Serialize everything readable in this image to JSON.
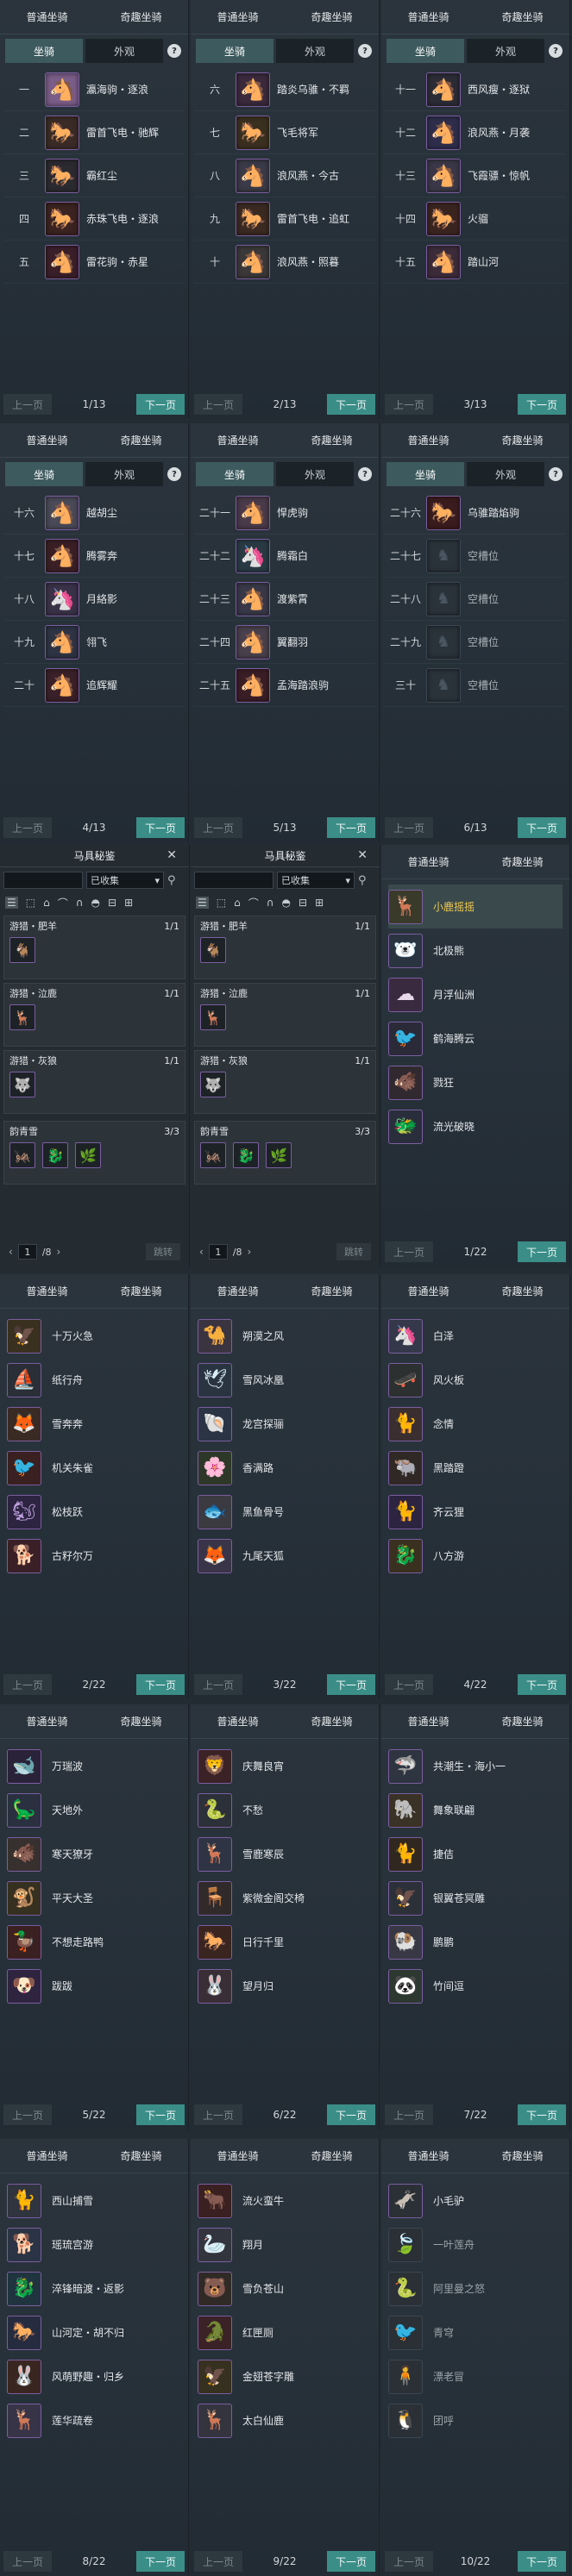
{
  "tabs": {
    "normal": "普通坐骑",
    "fun": "奇趣坐骑",
    "mount": "坐骑",
    "appearance": "外观",
    "help": "?"
  },
  "pager": {
    "prev": "上一页",
    "next": "下一页"
  },
  "mount_pages": [
    {
      "page": "1/13",
      "rows": [
        {
          "rank": "一",
          "name": "瀛海驹・逐浪",
          "icon": "🐴",
          "color": "#b9c7d6",
          "bg": "#7a5d88"
        },
        {
          "rank": "二",
          "name": "雷首飞电・驰辉",
          "icon": "🐎",
          "color": "#e0a040",
          "bg": "#3a2b26"
        },
        {
          "rank": "三",
          "name": "霸红尘",
          "icon": "🐎",
          "color": "#e4e7ea",
          "bg": "#2b2a30"
        },
        {
          "rank": "四",
          "name": "赤珠飞电・逐浪",
          "icon": "🐎",
          "color": "#e47a3a",
          "bg": "#3a2320"
        },
        {
          "rank": "五",
          "name": "雷花驹・赤星",
          "icon": "🐴",
          "color": "#d44a5a",
          "bg": "#3a1f2a"
        }
      ]
    },
    {
      "page": "2/13",
      "rows": [
        {
          "rank": "六",
          "name": "踏炎乌骓・不羁",
          "icon": "🐴",
          "color": "#e0e4e8",
          "bg": "#3a2a3c"
        },
        {
          "rank": "七",
          "name": "飞毛将军",
          "icon": "🐎",
          "color": "#e8b84a",
          "bg": "#3a3020"
        },
        {
          "rank": "八",
          "name": "浪风燕・今古",
          "icon": "🐴",
          "color": "#e6eaee",
          "bg": "#3a3a48"
        },
        {
          "rank": "九",
          "name": "雷首飞电・追虹",
          "icon": "🐎",
          "color": "#e6b048",
          "bg": "#3a2a22"
        },
        {
          "rank": "十",
          "name": "浪风燕・照暮",
          "icon": "🐴",
          "color": "#e8e4d8",
          "bg": "#3a3838"
        }
      ]
    },
    {
      "page": "3/13",
      "rows": [
        {
          "rank": "十一",
          "name": "西风瘦・逐狱",
          "icon": "🐴",
          "color": "#cfd5dd",
          "bg": "#2c2c36"
        },
        {
          "rank": "十二",
          "name": "浪风燕・月袭",
          "icon": "🐴",
          "color": "#a4b7e8",
          "bg": "#2e2e4c"
        },
        {
          "rank": "十三",
          "name": "飞霞骠・惊帆",
          "icon": "🐴",
          "color": "#e8ecef",
          "bg": "#3a3848"
        },
        {
          "rank": "十四",
          "name": "火骝",
          "icon": "🐎",
          "color": "#ea7a3a",
          "bg": "#3a2420"
        },
        {
          "rank": "十五",
          "name": "踏山河",
          "icon": "🐴",
          "color": "#e8d8dc",
          "bg": "#3c2c3a"
        }
      ]
    },
    {
      "page": "4/13",
      "rows": [
        {
          "rank": "十六",
          "name": "越胡尘",
          "icon": "🐴",
          "color": "#2a2f36",
          "bg": "#4a4a58"
        },
        {
          "rank": "十七",
          "name": "腾雾奔",
          "icon": "🐴",
          "color": "#e25a3a",
          "bg": "#3a2026"
        },
        {
          "rank": "十八",
          "name": "月絡影",
          "icon": "🦄",
          "color": "#e6e8f4",
          "bg": "#3a3248"
        },
        {
          "rank": "十九",
          "name": "翎飞",
          "icon": "🐴",
          "color": "#c0c8d8",
          "bg": "#2e3444"
        },
        {
          "rank": "二十",
          "name": "追辉耀",
          "icon": "🐴",
          "color": "#e86a4a",
          "bg": "#3a2028"
        }
      ]
    },
    {
      "page": "5/13",
      "rows": [
        {
          "rank": "二十一",
          "name": "悍虎驹",
          "icon": "🐴",
          "color": "#d8dce8",
          "bg": "#4a3a4a"
        },
        {
          "rank": "二十二",
          "name": "腾霜白",
          "icon": "🦄",
          "color": "#dcf0f4",
          "bg": "#2a3a44"
        },
        {
          "rank": "二十三",
          "name": "渡紫霄",
          "icon": "🐴",
          "color": "#e8ecf0",
          "bg": "#383848"
        },
        {
          "rank": "二十四",
          "name": "翼翻羽",
          "icon": "🐴",
          "color": "#2c2a30",
          "bg": "#48404c"
        },
        {
          "rank": "二十五",
          "name": "孟海踏浪驹",
          "icon": "🐴",
          "color": "#e04a4a",
          "bg": "#3a1e26"
        }
      ]
    },
    {
      "page": "6/13",
      "rows": [
        {
          "rank": "二十六",
          "name": "乌骓踏焰驹",
          "icon": "🐎",
          "color": "#e4483a",
          "bg": "#3a1c1e",
          "empty": false
        },
        {
          "rank": "二十七",
          "name": "空槽位",
          "icon": "♞",
          "empty": true
        },
        {
          "rank": "二十八",
          "name": "空槽位",
          "icon": "♞",
          "empty": true
        },
        {
          "rank": "二十九",
          "name": "空槽位",
          "icon": "♞",
          "empty": true
        },
        {
          "rank": "三十",
          "name": "空槽位",
          "icon": "♞",
          "empty": true
        }
      ]
    }
  ],
  "codex": {
    "title": "马具秘鉴",
    "close": "✕",
    "search_placeholder": "",
    "filter_value": "已收集",
    "sets": [
      {
        "name": "游猎・肥羊",
        "count": "1/1",
        "items": [
          "🐐"
        ]
      },
      {
        "name": "游猎・泣鹿",
        "count": "1/1",
        "items": [
          "🦌"
        ]
      },
      {
        "name": "游猎・灰狼",
        "count": "1/1",
        "items": [
          "🐺"
        ]
      }
    ],
    "set_bottom": {
      "name": "韵青雪",
      "count": "3/3",
      "items": [
        "🦗",
        "🐉",
        "🌿"
      ]
    },
    "page_current": "1",
    "page_total": "/8",
    "jump": "跳转"
  },
  "fun_pages": [
    {
      "page": "1/22",
      "rows": [
        {
          "name": "小鹿摇摇",
          "icon": "🦌",
          "color": "#f0c060",
          "bg": "#3a3a2a",
          "selected": true
        },
        {
          "name": "北极熊",
          "icon": "🐻‍❄️",
          "color": "#e8f0f4",
          "bg": "#2a3440"
        },
        {
          "name": "月浮仙洲",
          "icon": "☁",
          "color": "#e8d8ea",
          "bg": "#3a2a40"
        },
        {
          "name": "鹤海腾云",
          "icon": "🐦",
          "color": "#f0f0f0",
          "bg": "#2a2a38"
        },
        {
          "name": "戮狂",
          "icon": "🐗",
          "color": "#d8d8d8",
          "bg": "#302a30"
        },
        {
          "name": "流光破晓",
          "icon": "🐲",
          "color": "#d8e8f0",
          "bg": "#2a2e3c"
        }
      ]
    },
    {
      "page": "2/22",
      "rows": [
        {
          "name": "十万火急",
          "icon": "🦅",
          "color": "#f0b040",
          "bg": "#3a3020"
        },
        {
          "name": "纸行舟",
          "icon": "⛵",
          "color": "#e8e8e8",
          "bg": "#2a2e36"
        },
        {
          "name": "雪奔奔",
          "icon": "🦊",
          "color": "#e8d8c0",
          "bg": "#3a2a24"
        },
        {
          "name": "机关朱雀",
          "icon": "🐦",
          "color": "#e85a3a",
          "bg": "#3a2020"
        },
        {
          "name": "松枝跃",
          "icon": "🐿",
          "color": "#c0a0e0",
          "bg": "#2c2440"
        },
        {
          "name": "古籽尔万",
          "icon": "🐕",
          "color": "#e06a6a",
          "bg": "#3a2026"
        }
      ]
    },
    {
      "page": "3/22",
      "rows": [
        {
          "name": "朔漠之风",
          "icon": "🐪",
          "color": "#e8e4dc",
          "bg": "#3a3440"
        },
        {
          "name": "雪风冰凰",
          "icon": "🕊",
          "color": "#d8eef8",
          "bg": "#2a3440"
        },
        {
          "name": "龙宫探骊",
          "icon": "🐚",
          "color": "#c8e0f0",
          "bg": "#2a3444"
        },
        {
          "name": "香满路",
          "icon": "🌸",
          "color": "#e0e8a0",
          "bg": "#2e3828"
        },
        {
          "name": "黑鱼骨号",
          "icon": "🐟",
          "color": "#2a2a2e",
          "bg": "#3a3a40"
        },
        {
          "name": "九尾天狐",
          "icon": "🦊",
          "color": "#f0f0f4",
          "bg": "#3a3448"
        }
      ]
    },
    {
      "page": "4/22",
      "rows": [
        {
          "name": "白泽",
          "icon": "🦄",
          "color": "#e8ecf0",
          "bg": "#34384a"
        },
        {
          "name": "风火板",
          "icon": "🛹",
          "color": "#e0a060",
          "bg": "#2c3030"
        },
        {
          "name": "念情",
          "icon": "🐈",
          "color": "#e8d8d0",
          "bg": "#3a2e30"
        },
        {
          "name": "黑踏蹬",
          "icon": "🐃",
          "color": "#d8a870",
          "bg": "#302824"
        },
        {
          "name": "齐云狸",
          "icon": "🐈",
          "color": "#c080e0",
          "bg": "#2c2440"
        },
        {
          "name": "八方游",
          "icon": "🐉",
          "color": "#e0b040",
          "bg": "#3a3020"
        }
      ]
    },
    {
      "page": "5/22",
      "rows": [
        {
          "name": "万瑞波",
          "icon": "🐋",
          "color": "#a050c0",
          "bg": "#2a2238"
        },
        {
          "name": "天地外",
          "icon": "🦕",
          "color": "#c8d8e8",
          "bg": "#2a3040"
        },
        {
          "name": "寒天獠牙",
          "icon": "🐗",
          "color": "#e0d8d0",
          "bg": "#36302e"
        },
        {
          "name": "平天大圣",
          "icon": "🐒",
          "color": "#e0c048",
          "bg": "#363020"
        },
        {
          "name": "不想走路鸭",
          "icon": "🦆",
          "color": "#e84a3a",
          "bg": "#3a2020"
        },
        {
          "name": "跋跋",
          "icon": "🐶",
          "color": "#c070d0",
          "bg": "#2e2440"
        }
      ]
    },
    {
      "page": "6/22",
      "rows": [
        {
          "name": "庆舞良宵",
          "icon": "🦁",
          "color": "#e04a4a",
          "bg": "#3a2226"
        },
        {
          "name": "不愁",
          "icon": "🐍",
          "color": "#d8dce0",
          "bg": "#2c3038"
        },
        {
          "name": "雪鹿寒辰",
          "icon": "🦌",
          "color": "#e8f0f8",
          "bg": "#2e3444"
        },
        {
          "name": "紫微金阁交椅",
          "icon": "🪑",
          "color": "#c0a050",
          "bg": "#302a2a"
        },
        {
          "name": "日行千里",
          "icon": "🐎",
          "color": "#e06040",
          "bg": "#3a2420"
        },
        {
          "name": "望月归",
          "icon": "🐰",
          "color": "#e0b8c8",
          "bg": "#3a2e36"
        }
      ]
    },
    {
      "page": "7/22",
      "rows": [
        {
          "name": "共潮生・海小一",
          "icon": "🦈",
          "color": "#d8e0e8",
          "bg": "#2e3440"
        },
        {
          "name": "舞象联翩",
          "icon": "🐘",
          "color": "#e8d0a0",
          "bg": "#3a3226"
        },
        {
          "name": "捷佶",
          "icon": "🐈",
          "color": "#e0a050",
          "bg": "#302820"
        },
        {
          "name": "银翼苍冥雕",
          "icon": "🦅",
          "color": "#c0c8d0",
          "bg": "#2c3038"
        },
        {
          "name": "鹏鹏",
          "icon": "🐏",
          "color": "#f0f0f0",
          "bg": "#383844"
        },
        {
          "name": "竹间逗",
          "icon": "🐼",
          "color": "#e8e8e8",
          "bg": "#2c3830"
        }
      ]
    },
    {
      "page": "8/22",
      "rows": [
        {
          "name": "西山捕雪",
          "icon": "🐈",
          "color": "#e8ecf0",
          "bg": "#30343e"
        },
        {
          "name": "瑶琉宫游",
          "icon": "🐕",
          "color": "#c8e0f0",
          "bg": "#2a3444"
        },
        {
          "name": "淬锋暗渡・返影",
          "icon": "🐉",
          "color": "#40c0e0",
          "bg": "#203440"
        },
        {
          "name": "山河定・胡不归",
          "icon": "🐎",
          "color": "#80a0d0",
          "bg": "#262c40"
        },
        {
          "name": "风萌野趣・归乡",
          "icon": "🐰",
          "color": "#d06a30",
          "bg": "#3a2620"
        },
        {
          "name": "莲华疏卷",
          "icon": "🦌",
          "color": "#e8e4f0",
          "bg": "#383448"
        }
      ]
    },
    {
      "page": "9/22",
      "rows": [
        {
          "name": "流火蛮牛",
          "icon": "🐂",
          "color": "#e84a3a",
          "bg": "#3a2020"
        },
        {
          "name": "翔月",
          "icon": "🦢",
          "color": "#e8ecf0",
          "bg": "#32343e"
        },
        {
          "name": "雪负苍山",
          "icon": "🐻",
          "color": "#c8a070",
          "bg": "#302a26"
        },
        {
          "name": "红匣厕",
          "icon": "🐊",
          "color": "#e06a5a",
          "bg": "#3a2226"
        },
        {
          "name": "金翅苍字雕",
          "icon": "🦅",
          "color": "#e0b040",
          "bg": "#363020"
        },
        {
          "name": "太白仙鹿",
          "icon": "🦌",
          "color": "#e0e4ec",
          "bg": "#34343e"
        }
      ]
    },
    {
      "page": "10/22",
      "rows": [
        {
          "name": "小毛驴",
          "icon": "🫏",
          "color": "#a8b0b8",
          "bg": "#2a3036",
          "dim": false
        },
        {
          "name": "一叶莲舟",
          "icon": "🍃",
          "color": "#4a5560",
          "bg": "#2a3036",
          "dim": true
        },
        {
          "name": "阿里曼之怒",
          "icon": "🐍",
          "color": "#4a5560",
          "bg": "#2a3036",
          "dim": true
        },
        {
          "name": "青穹",
          "icon": "🐦",
          "color": "#4a5560",
          "bg": "#2a3036",
          "dim": true
        },
        {
          "name": "漂老冒",
          "icon": "🧍",
          "color": "#4a5560",
          "bg": "#2a3036",
          "dim": true
        },
        {
          "name": "团呼",
          "icon": "🐧",
          "color": "#4a5560",
          "bg": "#2a3036",
          "dim": true
        }
      ]
    }
  ]
}
